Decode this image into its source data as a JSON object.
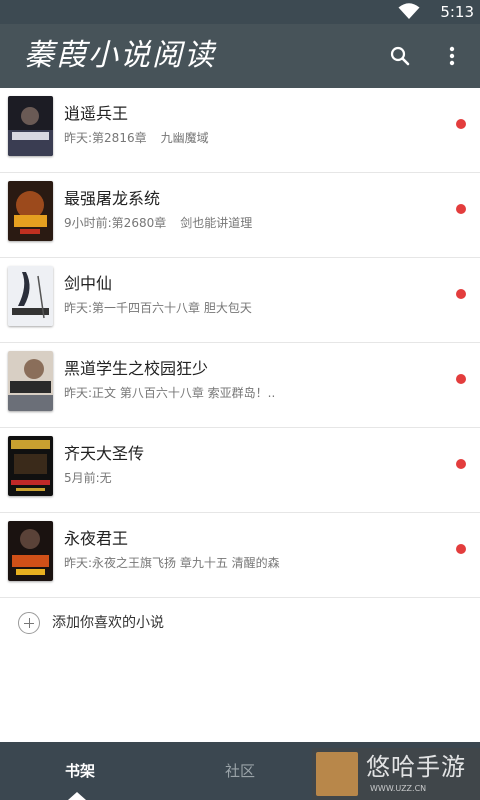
{
  "status_bar": {
    "time": "5:13",
    "wifi_icon": "wifi-icon"
  },
  "toolbar": {
    "title": "蓁葭小说阅读",
    "search_icon": "search-icon",
    "menu_icon": "more-vert-icon"
  },
  "books": [
    {
      "title": "逍遥兵王",
      "updated": "昨天:第2816章",
      "chapter": "九幽魔域",
      "unread": true
    },
    {
      "title": "最强屠龙系统",
      "updated": "9小时前:第2680章",
      "chapter": "剑也能讲道理",
      "unread": true
    },
    {
      "title": "剑中仙",
      "updated": "昨天:第一千四百六十八章 胆大包天",
      "chapter": "",
      "unread": true
    },
    {
      "title": "黑道学生之校园狂少",
      "updated": "昨天:正文 第八百六十八章 索亚群岛！..",
      "chapter": "",
      "unread": true
    },
    {
      "title": "齐天大圣传",
      "updated": "5月前:无",
      "chapter": "",
      "unread": true
    },
    {
      "title": "永夜君王",
      "updated": "昨天:永夜之王旗飞扬 章九十五 清醒的森",
      "chapter": "",
      "unread": true
    }
  ],
  "add_book": {
    "label": "添加你喜欢的小说",
    "icon": "add-circle-icon"
  },
  "bottom_nav": {
    "tabs": [
      {
        "label": "书架",
        "active": true
      },
      {
        "label": "社区",
        "active": false
      }
    ]
  },
  "watermark": {
    "text": "悠哈手游",
    "url": "WWW.UZZ.CN"
  },
  "colors": {
    "status_bar": "#3d4a52",
    "toolbar": "#475359",
    "bottom_bar": "#3b4750",
    "unread_dot": "#e33d3d"
  }
}
